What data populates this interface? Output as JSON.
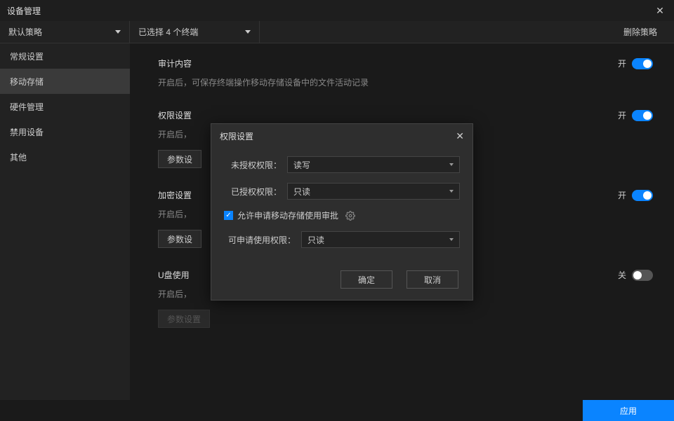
{
  "window": {
    "title": "设备管理"
  },
  "toolbar": {
    "policy_dropdown": "默认策略",
    "terminals_dropdown": "已选择 4 个终端",
    "delete_policy": "删除策略"
  },
  "sidebar": {
    "items": [
      {
        "label": "常规设置"
      },
      {
        "label": "移动存储"
      },
      {
        "label": "硬件管理"
      },
      {
        "label": "禁用设备"
      },
      {
        "label": "其他"
      }
    ]
  },
  "content": {
    "sections": [
      {
        "title": "审计内容",
        "desc": "开启后，可保存终端操作移动存储设备中的文件活动记录",
        "toggle_label": "开",
        "toggle_on": true,
        "has_param": false
      },
      {
        "title": "权限设置",
        "desc": "开启后，",
        "toggle_label": "开",
        "toggle_on": true,
        "has_param": true,
        "param_label": "参数设"
      },
      {
        "title": "加密设置",
        "desc": "开启后，",
        "toggle_label": "开",
        "toggle_on": true,
        "has_param": true,
        "param_label": "参数设"
      },
      {
        "title": "U盘使用",
        "desc": "开启后，",
        "toggle_label": "关",
        "toggle_on": false,
        "has_param": true,
        "param_label": "参数设置",
        "param_disabled": true
      }
    ]
  },
  "modal": {
    "title": "权限设置",
    "rows": [
      {
        "label": "未授权权限：",
        "value": "读写"
      },
      {
        "label": "已授权权限：",
        "value": "只读"
      }
    ],
    "checkbox_label": "允许申请移动存储使用审批",
    "row3": {
      "label": "可申请使用权限：",
      "value": "只读"
    },
    "ok": "确定",
    "cancel": "取消"
  },
  "footer": {
    "apply": "应用"
  }
}
